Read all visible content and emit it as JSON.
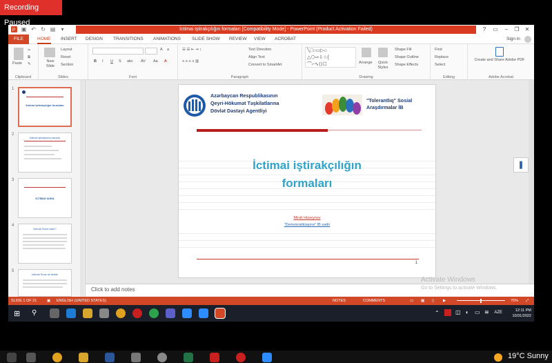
{
  "recording": {
    "label": "Recording Paused"
  },
  "window": {
    "title": "İctimai iştirakçılığın formaları [Compatibility Mode] - PowerPoint (Product Activation Failed)",
    "help": "?",
    "sign_in": "Sign in"
  },
  "tabs": [
    "FILE",
    "HOME",
    "INSERT",
    "DESIGN",
    "TRANSITIONS",
    "ANIMATIONS",
    "SLIDE SHOW",
    "REVIEW",
    "VIEW",
    "ACROBAT"
  ],
  "ribbon": {
    "clipboard": {
      "paste": "Paste",
      "label": "Clipboard"
    },
    "slides": {
      "new_slide": "New Slide",
      "layout": "Layout",
      "reset": "Reset",
      "section": "Section",
      "label": "Slides"
    },
    "font": {
      "label": "Font"
    },
    "paragraph": {
      "text_direction": "Text Direction",
      "align_text": "Align Text",
      "smartart": "Convert to SmartArt",
      "label": "Paragraph"
    },
    "drawing": {
      "arrange": "Arrange",
      "quick_styles": "Quick Styles",
      "shape_fill": "Shape Fill",
      "shape_outline": "Shape Outline",
      "shape_effects": "Shape Effects",
      "label": "Drawing"
    },
    "editing": {
      "find": "Find",
      "replace": "Replace",
      "select": "Select",
      "label": "Editing"
    },
    "acrobat": {
      "create_share": "Create and Share Adobe PDF",
      "label": "Adobe Acrobat"
    }
  },
  "thumbnails": [
    {
      "num": "1",
      "title": "İctimai iştirakçılığın formaları"
    },
    {
      "num": "2",
      "title": "İctimai iştirakçılıq barədə"
    },
    {
      "num": "3",
      "title": "İCTİMAİ SURA"
    },
    {
      "num": "4",
      "title": "İctimai Sura nədir?"
    },
    {
      "num": "5",
      "title": "İctimai Sura ne tedbir"
    }
  ],
  "slide": {
    "agency_lines": [
      "Azərbaycan Respublikasının",
      "Qeyri-Hökumət Təşkilatlarına",
      "Dövlət Dəstəyi Agentliyi"
    ],
    "tolerance_lines": [
      "\"Tolerantlıq\" Sosial",
      "Araşdırmalar İB"
    ],
    "title_lines": [
      "İctimai iştirakçılığın",
      "formaları"
    ],
    "author": "Mirəli Hüseynov",
    "org_prefix": "\"Demokratikləşmə\"",
    "org_link": "\"Demokratikləşmə\" İB sədri",
    "page_number": "1"
  },
  "notes": {
    "placeholder": "Click to add notes"
  },
  "watermark": {
    "line1": "Activate Windows",
    "line2": "Go to Settings to activate Windows."
  },
  "status": {
    "slide_of": "SLIDE 1 OF 21",
    "language": "ENGLISH (UNITED STATES)",
    "notes": "NOTES",
    "comments": "COMMENTS",
    "zoom": "76%"
  },
  "taskbar": {
    "lang": "AZE",
    "time": "12:11 PM",
    "date": "10/31/2022"
  },
  "host": {
    "weather": "19°C  Sunny"
  },
  "colors": {
    "accent": "#d24726",
    "title_blue": "#2fa3c8"
  }
}
